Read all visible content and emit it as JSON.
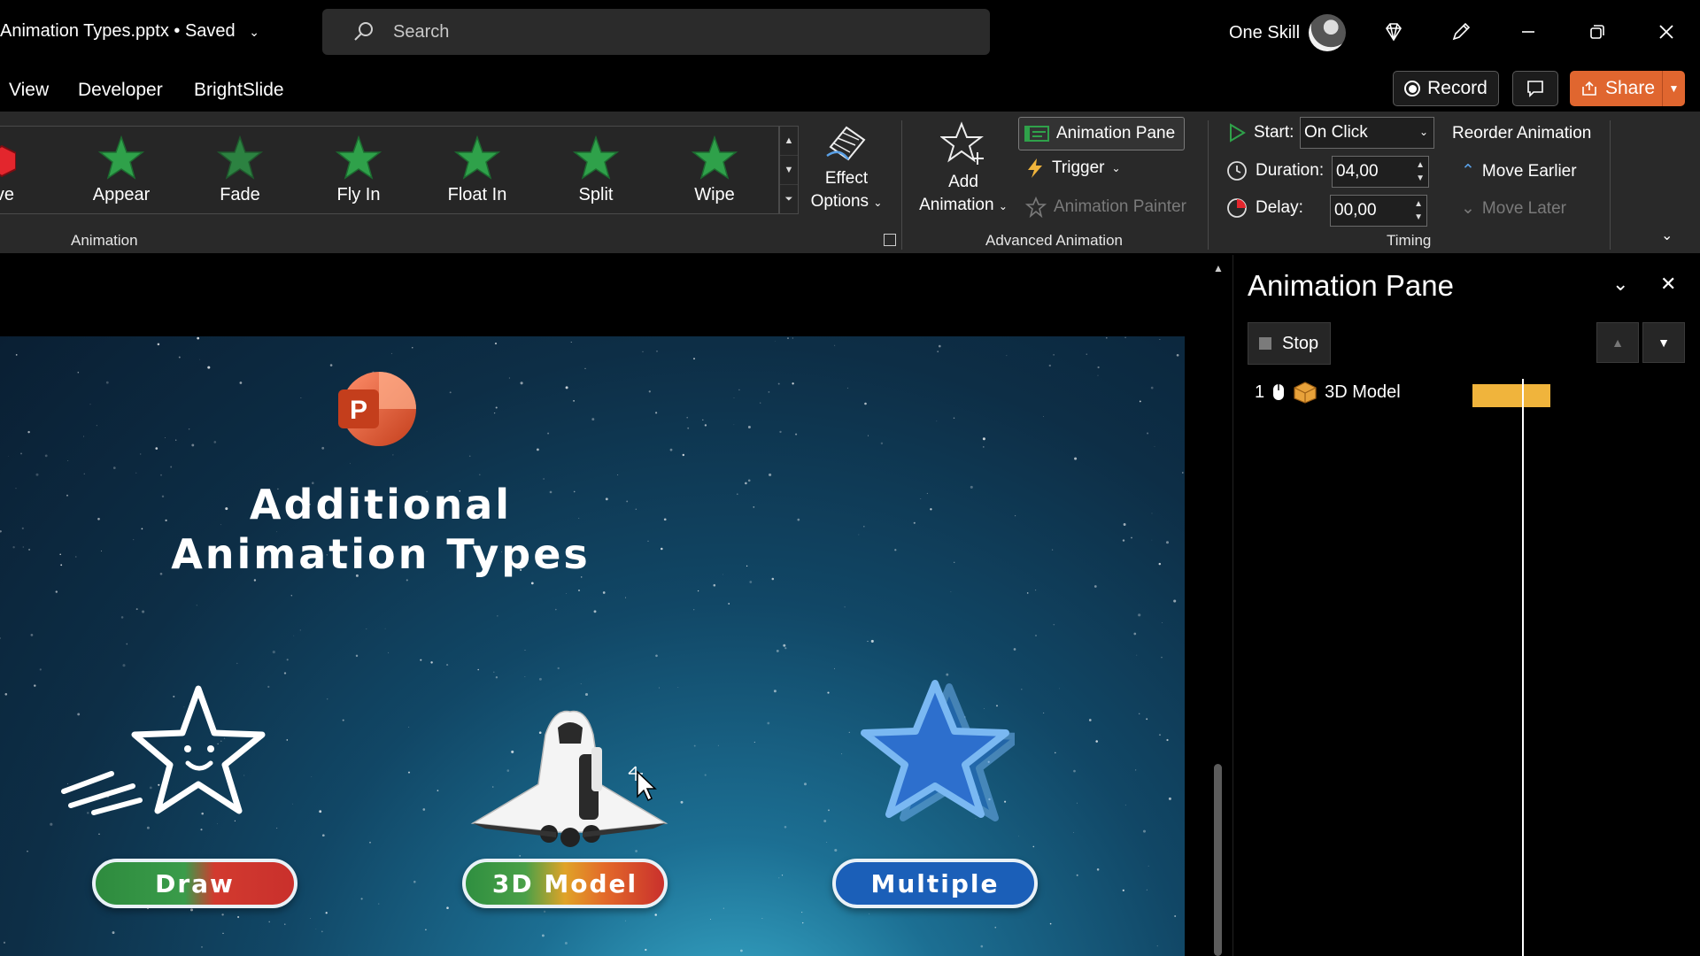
{
  "titlebar": {
    "file_title": "Animation Types.pptx • Saved",
    "search_placeholder": "Search",
    "user_name": "One Skill"
  },
  "tabs": [
    "View",
    "Developer",
    "BrightSlide"
  ],
  "header_buttons": {
    "record": "Record",
    "share": "Share"
  },
  "ribbon": {
    "gallery": {
      "partial_item": "ave",
      "items": [
        "Appear",
        "Fade",
        "Fly In",
        "Float In",
        "Split",
        "Wipe"
      ]
    },
    "effect_options": [
      "Effect",
      "Options"
    ],
    "animation_group_label": "Animation",
    "add_animation": [
      "Add",
      "Animation"
    ],
    "animation_pane_button": "Animation Pane",
    "trigger": "Trigger",
    "animation_painter": "Animation Painter",
    "advanced_group_label": "Advanced Animation",
    "timing": {
      "start_label": "Start:",
      "start_value": "On Click",
      "duration_label": "Duration:",
      "duration_value": "04,00",
      "delay_label": "Delay:",
      "delay_value": "00,00",
      "group_label": "Timing"
    },
    "reorder": {
      "title": "Reorder Animation",
      "earlier": "Move Earlier",
      "later": "Move Later"
    }
  },
  "slide": {
    "logo_letter": "P",
    "title_line1": "Additional",
    "title_line2": "Animation Types",
    "pills": [
      "Draw",
      "3D Model",
      "Multiple"
    ]
  },
  "animation_pane": {
    "title": "Animation Pane",
    "stop": "Stop",
    "items": [
      {
        "number": "1",
        "name": "3D Model"
      }
    ]
  },
  "colors": {
    "share_orange": "#e0662f",
    "star_green": "#2fa14a",
    "timeline_bar": "#f0b43c",
    "multiple_blue": "#1b5fb8"
  }
}
